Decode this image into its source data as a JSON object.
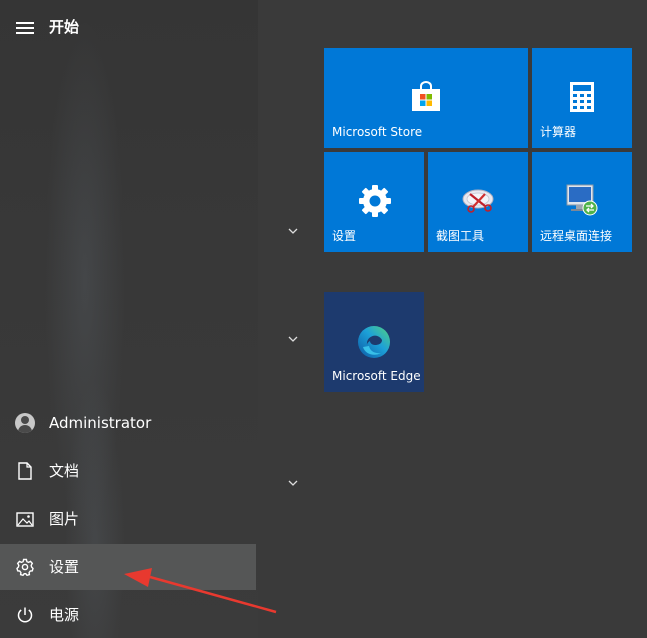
{
  "start_menu": {
    "title": "开始"
  },
  "nav": {
    "user": "Administrator",
    "documents": "文档",
    "pictures": "图片",
    "settings": "设置",
    "power": "电源"
  },
  "tiles": {
    "store": "Microsoft Store",
    "calculator": "计算器",
    "settings": "设置",
    "snipping": "截图工具",
    "remote_desktop": "远程桌面连接",
    "edge": "Microsoft Edge"
  },
  "colors": {
    "tile_blue": "#0078d7",
    "edge_tile": "#1d3a6e",
    "annotation_arrow": "#e8392f"
  }
}
